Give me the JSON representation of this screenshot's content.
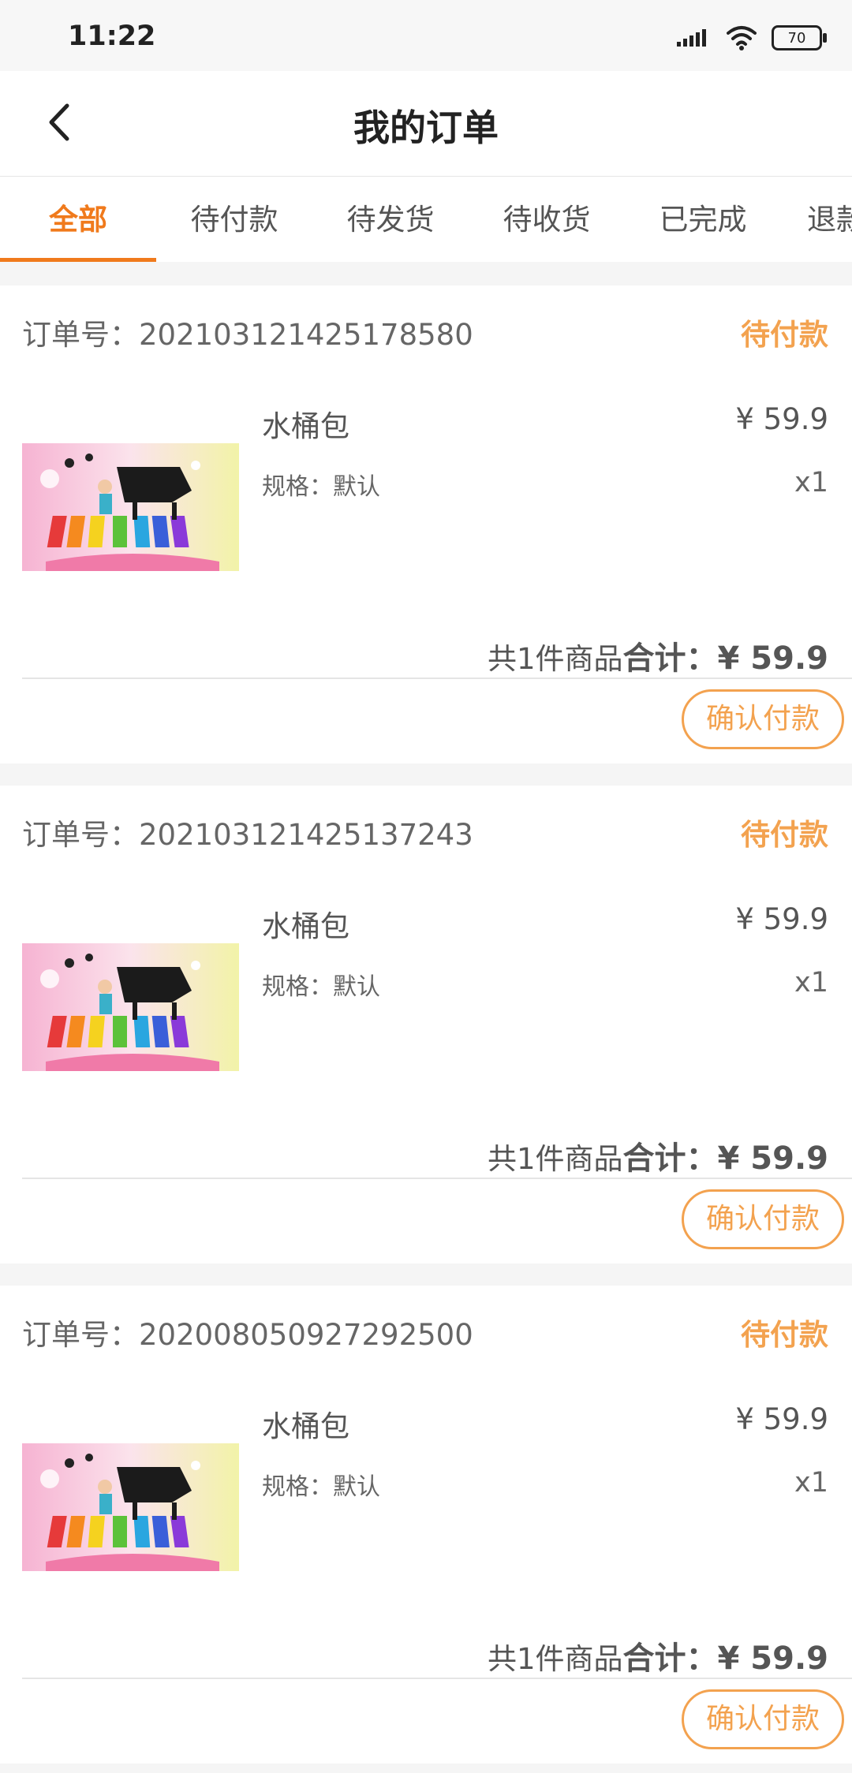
{
  "status_bar": {
    "time": "11:22",
    "battery": "70"
  },
  "header": {
    "title": "我的订单"
  },
  "tabs": [
    {
      "label": "全部",
      "active": true
    },
    {
      "label": "待付款",
      "active": false
    },
    {
      "label": "待发货",
      "active": false
    },
    {
      "label": "待收货",
      "active": false
    },
    {
      "label": "已完成",
      "active": false
    },
    {
      "label": "退款",
      "active": false
    }
  ],
  "orders": [
    {
      "order_no_label": "订单号：",
      "order_no": "202103121425178580",
      "status": "待付款",
      "product": {
        "name": "水桶包",
        "spec": "规格：默认",
        "price": "¥ 59.9",
        "qty": "x1"
      },
      "summary": {
        "count_text": "共1件商品",
        "total_label": "合计：",
        "total": "¥ 59.9"
      },
      "action": "确认付款"
    },
    {
      "order_no_label": "订单号：",
      "order_no": "202103121425137243",
      "status": "待付款",
      "product": {
        "name": "水桶包",
        "spec": "规格：默认",
        "price": "¥ 59.9",
        "qty": "x1"
      },
      "summary": {
        "count_text": "共1件商品",
        "total_label": "合计：",
        "total": "¥ 59.9"
      },
      "action": "确认付款"
    },
    {
      "order_no_label": "订单号：",
      "order_no": "202008050927292500",
      "status": "待付款",
      "product": {
        "name": "水桶包",
        "spec": "规格：默认",
        "price": "¥ 59.9",
        "qty": "x1"
      },
      "summary": {
        "count_text": "共1件商品",
        "total_label": "合计：",
        "total": "¥ 59.9"
      },
      "action": "确认付款"
    }
  ],
  "colors": {
    "accent": "#f07a1c",
    "status": "#f3a24f"
  }
}
